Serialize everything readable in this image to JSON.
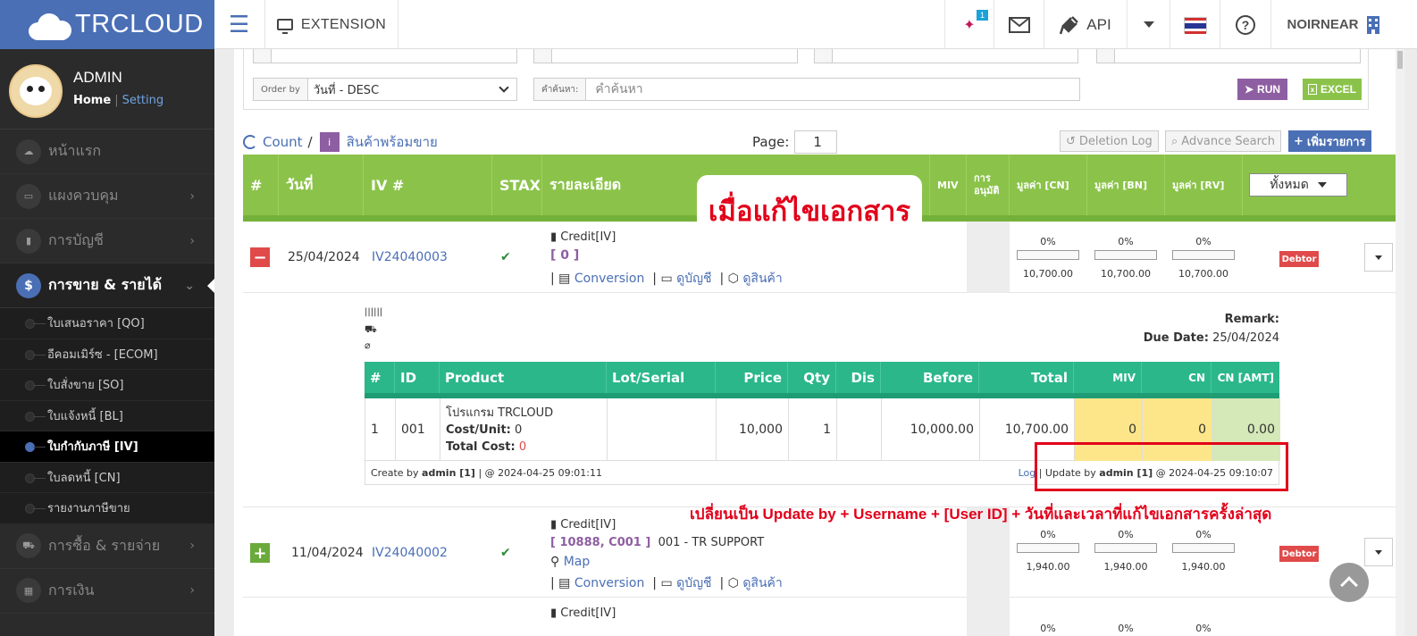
{
  "topbar": {
    "brand": "TRCLOUD",
    "extension": "EXTENSION",
    "notif_count": "1",
    "api": "API",
    "user": "NOIRNEAR"
  },
  "sidebar": {
    "name": "ADMIN",
    "home": "Home",
    "setting": "Setting",
    "items": [
      {
        "label": "หน้าแรก",
        "icon": "cloud-icon"
      },
      {
        "label": "แผงควบคุม",
        "icon": "monitor-icon"
      },
      {
        "label": "การบัญชี",
        "icon": "book-icon"
      },
      {
        "label": "การขาย & รายได้",
        "icon": "dollar-icon"
      }
    ],
    "subs": [
      "ใบเสนอราคา [QO]",
      "อีคอมเมิร์ซ - [ECOM]",
      "ใบสั่งขาย [SO]",
      "ใบแจ้งหนี้ [BL]",
      "ใบกำกับภาษี [IV]",
      "ใบลดหนี้ [CN]",
      "รายงานภาษีขาย"
    ],
    "items2": [
      {
        "label": "การซื้อ & รายจ่าย",
        "icon": "cart-icon"
      },
      {
        "label": "การเงิน",
        "icon": "calendar-icon"
      }
    ]
  },
  "filters": {
    "order_label": "Order by",
    "order_value": "วันที่ - DESC",
    "search_label": "คำค้นหา:",
    "search_placeholder": "คำค้นหา",
    "run": "RUN",
    "excel": "EXCEL"
  },
  "toolbar": {
    "count": "Count",
    "slash": "/",
    "category": "สินค้าพร้อมขาย",
    "page_label": "Page:",
    "page": "1",
    "deletion_log": "Deletion Log",
    "advance_search": "Advance Search",
    "add": "เพิ่มรายการ"
  },
  "table": {
    "headers": [
      "#",
      "วันที่",
      "IV #",
      "STAX",
      "รายละเอียด",
      "MIV",
      "การอนุมัติ",
      "มูลค่า [CN]",
      "มูลค่า [BN]",
      "มูลค่า [RV]"
    ],
    "filter": "ทั้งหมด",
    "rows": [
      {
        "date": "25/04/2024",
        "iv": "IV24040003",
        "type": "Credit[IV]",
        "ref": "[ 0 ]",
        "customer": "",
        "map": "",
        "conversion": "Conversion",
        "view_acc": "ดูบัญชี",
        "view_prod": "ดูสินค้า",
        "pcts": [
          "0%",
          "0%",
          "0%"
        ],
        "amts": [
          "10,700.00",
          "10,700.00",
          "10,700.00"
        ],
        "status": "Debtor"
      },
      {
        "date": "11/04/2024",
        "iv": "IV24040002",
        "type": "Credit[IV]",
        "ref": "[ 10888, C001 ]",
        "customer": "001 - TR SUPPORT",
        "map": "Map",
        "conversion": "Conversion",
        "view_acc": "ดูบัญชี",
        "view_prod": "ดูสินค้า",
        "pcts": [
          "0%",
          "0%",
          "0%"
        ],
        "amts": [
          "1,940.00",
          "1,940.00",
          "1,940.00"
        ],
        "status": "Debtor"
      }
    ],
    "row3": {
      "type": "Credit[IV]",
      "pct": "0%"
    }
  },
  "detail": {
    "remark": "Remark:",
    "due_label": "Due Date:",
    "due": "25/04/2024",
    "headers": [
      "#",
      "ID",
      "Product",
      "Lot/Serial",
      "Price",
      "Qty",
      "Dis",
      "Before",
      "Total",
      "MIV",
      "CN",
      "CN [AMT]"
    ],
    "row": {
      "no": "1",
      "id": "001",
      "product": "โปรแกรม TRCLOUD",
      "cost_label": "Cost/Unit:",
      "cost": "0",
      "total_cost_label": "Total Cost:",
      "total_cost": "0",
      "price": "10,000",
      "qty": "1",
      "dis": "",
      "before": "10,000.00",
      "total": "10,700.00",
      "miv": "0",
      "cn": "0",
      "cn_amt": "0.00"
    },
    "create_prefix": "Create by",
    "create_user": "admin [1]",
    "create_time": "| @ 2024-04-25 09:01:11",
    "log": "Log",
    "update_prefix": "| Update by",
    "update_user": "admin [1]",
    "update_time": "@ 2024-04-25 09:10:07"
  },
  "annotations": {
    "callout": "เมื่อแก้ไขเอกสาร",
    "note": "เปลี่ยนเป็น Update by + Username + [User ID] + วันที่และเวลาที่แก้ไขเอกสารครั้งล่าสุด"
  },
  "colors": {
    "brand": "#4a6fb5",
    "header_green": "#8bc34a",
    "detail_green": "#2bb78a",
    "annotation_red": "#e2001a"
  }
}
